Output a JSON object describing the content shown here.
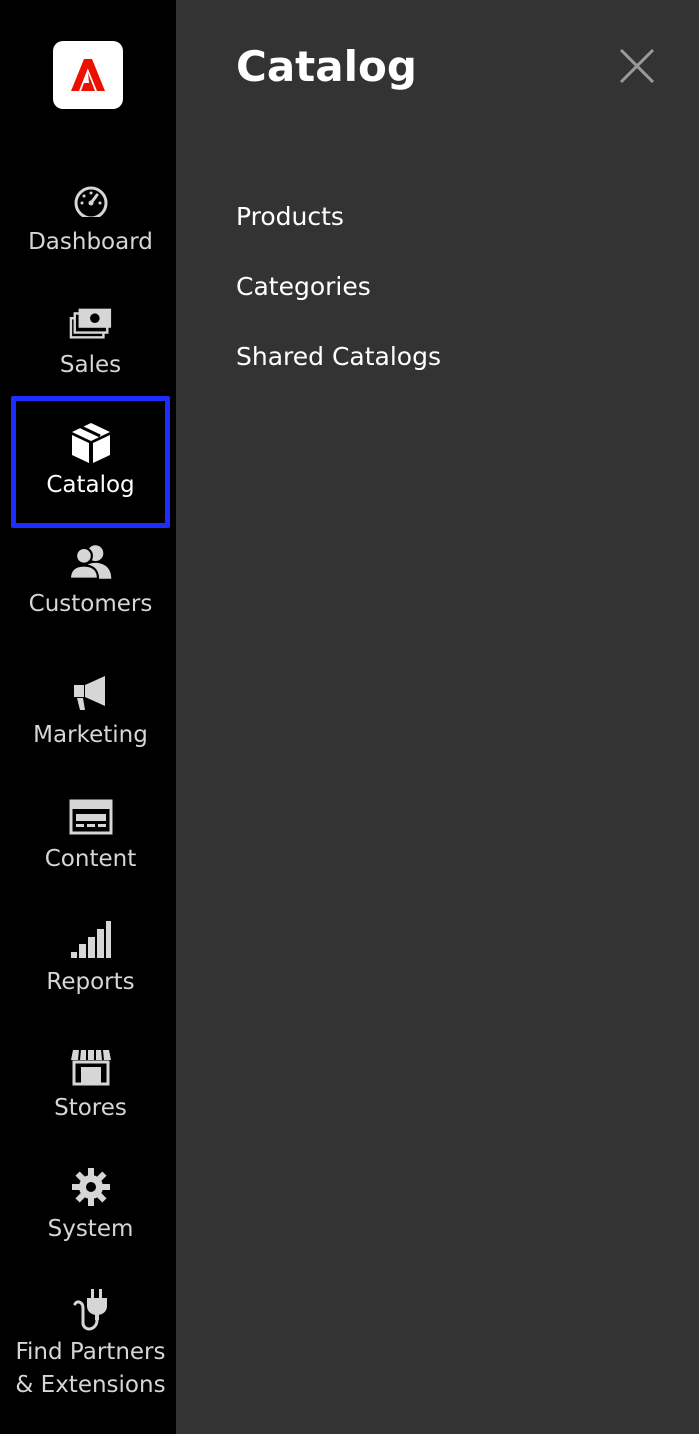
{
  "sidebar": {
    "logo_name": "adobe-logo",
    "items": [
      {
        "label": "Dashboard",
        "icon": "dashboard-gauge-icon"
      },
      {
        "label": "Sales",
        "icon": "sales-money-icon"
      },
      {
        "label": "Catalog",
        "icon": "catalog-box-icon",
        "active": true
      },
      {
        "label": "Customers",
        "icon": "customers-people-icon"
      },
      {
        "label": "Marketing",
        "icon": "marketing-megaphone-icon"
      },
      {
        "label": "Content",
        "icon": "content-layout-icon"
      },
      {
        "label": "Reports",
        "icon": "reports-bars-icon"
      },
      {
        "label": "Stores",
        "icon": "stores-shop-icon"
      },
      {
        "label": "System",
        "icon": "system-gear-icon"
      },
      {
        "label_line1": "Find Partners",
        "label_line2": "& Extensions",
        "icon": "extensions-plug-icon"
      }
    ]
  },
  "panel": {
    "title": "Catalog",
    "items": [
      "Products",
      "Categories",
      "Shared Catalogs"
    ]
  },
  "colors": {
    "sidebar_bg": "#000000",
    "panel_bg": "#333333",
    "active_border": "#1f2bff",
    "logo_red": "#eb1000"
  }
}
